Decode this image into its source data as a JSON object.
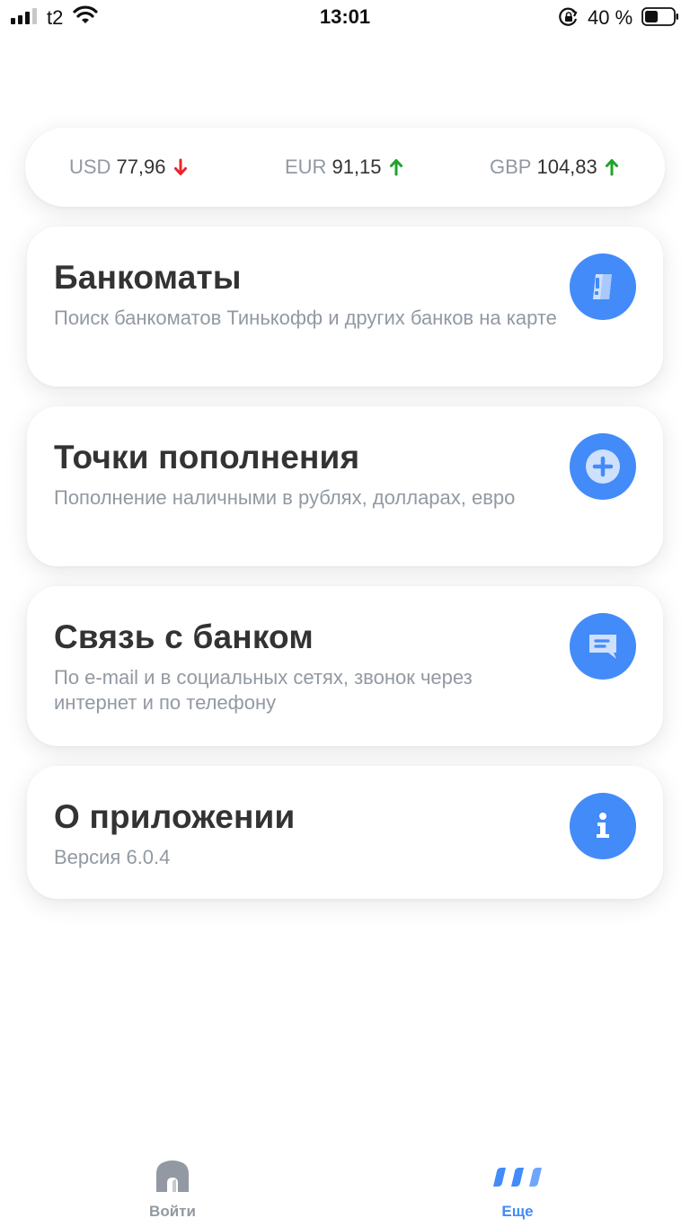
{
  "status_bar": {
    "carrier": "t2",
    "time": "13:01",
    "battery": "40 %"
  },
  "rates": [
    {
      "code": "USD",
      "value": "77,96",
      "trend": "down",
      "trend_color": "#e8262c"
    },
    {
      "code": "EUR",
      "value": "91,15",
      "trend": "up",
      "trend_color": "#1fa32c"
    },
    {
      "code": "GBP",
      "value": "104,83",
      "trend": "up",
      "trend_color": "#1fa32c"
    }
  ],
  "menu": {
    "atms": {
      "title": "Банкоматы",
      "subtitle": "Поиск банкоматов Тинькофф и других банков на карте",
      "icon": "atm-icon"
    },
    "topup": {
      "title": "Точки пополнения",
      "subtitle": "Пополнение наличными в рублях, долларах, евро",
      "icon": "plus-circle-icon"
    },
    "contact": {
      "title": "Связь с банком",
      "subtitle": "По e-mail и в социальных сетях, звонок через интернет и по телефону",
      "icon": "chat-icon"
    },
    "about": {
      "title": "О приложении",
      "subtitle": "Версия 6.0.4",
      "icon": "info-icon"
    }
  },
  "tabs": {
    "login": {
      "label": "Войти",
      "icon": "home-icon",
      "active": false
    },
    "more": {
      "label": "Еще",
      "icon": "dots-icon",
      "active": true
    }
  },
  "colors": {
    "accent": "#428bf9",
    "muted_text": "#9299a2",
    "title_text": "#333333"
  }
}
